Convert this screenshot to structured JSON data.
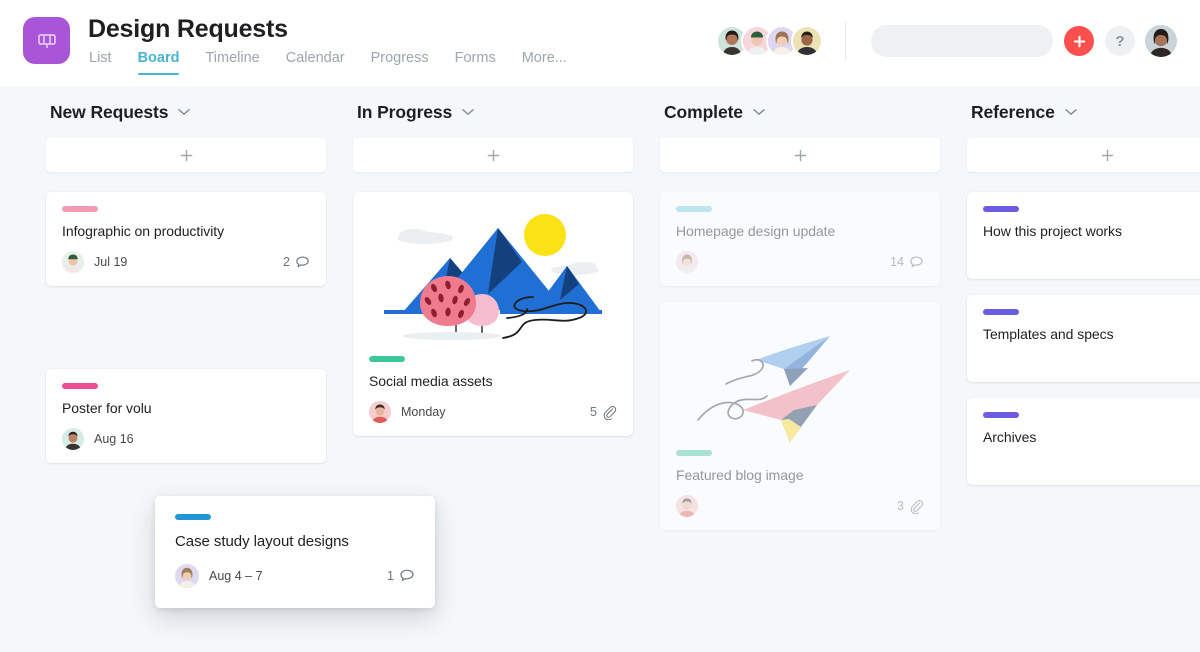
{
  "header": {
    "logo_icon": "project-logo-icon",
    "title": "Design Requests",
    "tabs": [
      {
        "label": "List",
        "active": false
      },
      {
        "label": "Board",
        "active": true
      },
      {
        "label": "Timeline",
        "active": false
      },
      {
        "label": "Calendar",
        "active": false
      },
      {
        "label": "Progress",
        "active": false
      },
      {
        "label": "Forms",
        "active": false
      },
      {
        "label": "More...",
        "active": false
      }
    ],
    "members": [
      {
        "name": "member-1",
        "bg": "#cfe4dd",
        "hair": "#2b2320",
        "skin": "#b3765a"
      },
      {
        "name": "member-2",
        "bg": "#f7d7dc",
        "hair": "#2f5e3c",
        "skin": "#f1c6ae"
      },
      {
        "name": "member-3",
        "bg": "#ded7f0",
        "hair": "#9a7456",
        "skin": "#f3cdb6"
      },
      {
        "name": "member-4",
        "bg": "#ece2b4",
        "hair": "#2b2018",
        "skin": "#9a6647"
      }
    ],
    "search": {
      "value": "",
      "placeholder": "",
      "icon": "search-icon"
    },
    "add_button": {
      "label": "+",
      "color": "#f9504f",
      "icon": "plus-icon"
    },
    "help_button": {
      "label": "?"
    },
    "profile": {
      "name": "profile-avatar",
      "bg": "#c9d3da",
      "hair": "#241c18",
      "skin": "#a9755a"
    }
  },
  "board": {
    "add_card_label": "+",
    "columns": [
      {
        "name": "New Requests",
        "cards": [
          {
            "title": "Infographic on productivity",
            "tag_color": "#f49ab4",
            "date": "Jul 19",
            "meta_value": "2",
            "meta_icon": "comment-icon",
            "avatar": {
              "bg": "#e7f0e9",
              "hair": "#2f5e3c",
              "skin": "#f0c3a8"
            },
            "dim": false
          },
          {
            "title": "Poster for volu",
            "tag_color": "#ef4d94",
            "date": "Aug 16",
            "meta_value": "",
            "meta_icon": "",
            "avatar": {
              "bg": "#d6ece7",
              "hair": "#2a2520",
              "skin": "#c08361"
            },
            "dim": false
          }
        ]
      },
      {
        "name": "In Progress",
        "cards": [
          {
            "title": "Social media assets",
            "tag_color": "#3ec79a",
            "date": "Monday",
            "meta_value": "5",
            "meta_icon": "attachment-icon",
            "illustration": "mountain-landscape",
            "avatar": {
              "bg": "#f6cdcd",
              "hair": "#3b2a22",
              "skin": "#e8b69c"
            },
            "dim": false
          }
        ]
      },
      {
        "name": "Complete",
        "cards": [
          {
            "title": "Homepage design update",
            "tag_color": "#78cde8",
            "date": "",
            "meta_value": "14",
            "meta_icon": "comment-icon",
            "avatar": {
              "bg": "#f3d9dd",
              "hair": "#8a6a52",
              "skin": "#f0c6ae"
            },
            "dim": true
          },
          {
            "title": "Featured blog image",
            "tag_color": "#4fc9a6",
            "date": "",
            "meta_value": "3",
            "meta_icon": "attachment-icon",
            "illustration": "paper-planes",
            "avatar": {
              "bg": "#f6c9c9",
              "hair": "#3b2a22",
              "skin": "#e9b79d"
            },
            "dim": true
          }
        ]
      },
      {
        "name": "Reference",
        "cards": [
          {
            "title": "How this project works",
            "tag_color": "#6b5ce0",
            "date": "",
            "meta_value": "",
            "meta_icon": "",
            "dim": false
          },
          {
            "title": "Templates and specs",
            "tag_color": "#6b5ce0",
            "date": "",
            "meta_value": "",
            "meta_icon": "",
            "dim": false
          },
          {
            "title": "Archives",
            "tag_color": "#6b5ce0",
            "date": "",
            "meta_value": "",
            "meta_icon": "",
            "dim": false
          }
        ]
      }
    ],
    "dragging_card": {
      "title": "Case study layout designs",
      "tag_color": "#2196d6",
      "date": "Aug 4 – 7",
      "meta_value": "1",
      "meta_icon": "comment-icon",
      "avatar": {
        "bg": "#e0d8f0",
        "hair": "#a07f5c",
        "skin": "#f0cdb4"
      }
    }
  },
  "colors": {
    "background": "#f5f8fa",
    "card": "#ffffff",
    "accent": "#4ab3d1",
    "logo": "#a855d8",
    "add": "#f9504f",
    "text": "#1e1f21",
    "muted": "#9ca6af"
  }
}
